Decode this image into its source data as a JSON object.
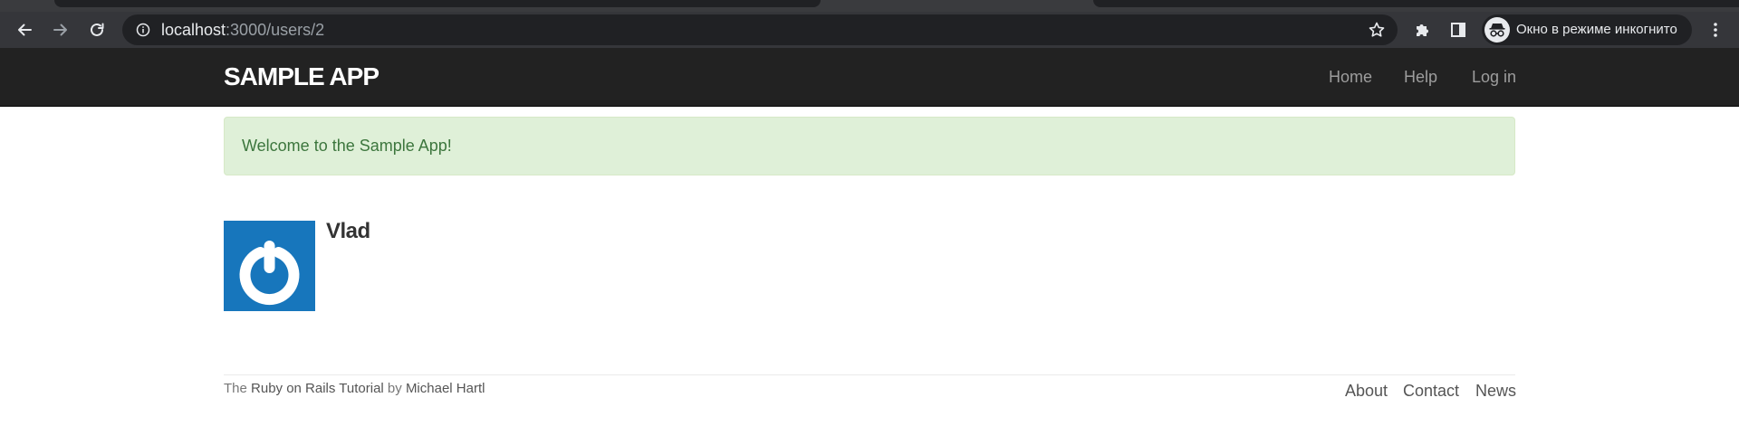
{
  "browser": {
    "url_host": "localhost",
    "url_rest": ":3000/users/2",
    "incognito_label": "Окно в режиме инкогнито",
    "icons": [
      "back-icon",
      "forward-icon",
      "reload-icon",
      "site-info-icon",
      "bookmark-star-icon",
      "extensions-icon",
      "side-panel-icon",
      "incognito-icon",
      "menu-icon"
    ]
  },
  "navbar": {
    "logo": "SAMPLE APP",
    "links": {
      "home": "Home",
      "help": "Help",
      "login": "Log in"
    }
  },
  "flash": {
    "message": "Welcome to the Sample App!",
    "color": "#3c763d",
    "background": "#dff0d8"
  },
  "user": {
    "name": "Vlad",
    "avatar_color": "#1776bc"
  },
  "footer": {
    "credit_prefix": "The ",
    "credit_link": "Ruby on Rails Tutorial",
    "credit_middle": " by ",
    "credit_author": "Michael Hartl",
    "links": {
      "about": "About",
      "contact": "Contact",
      "news": "News"
    }
  }
}
